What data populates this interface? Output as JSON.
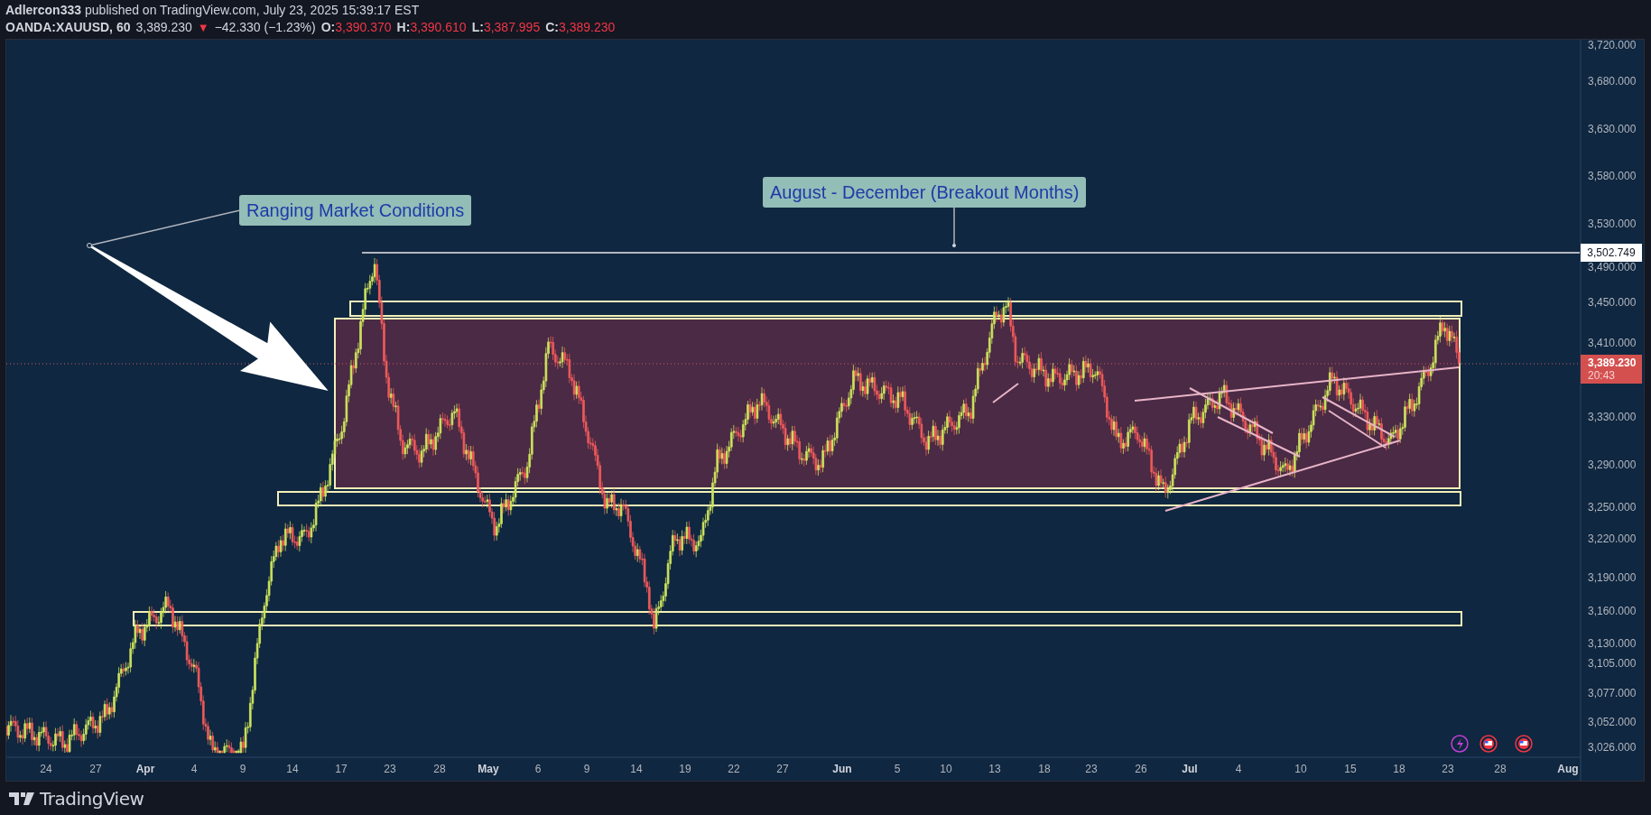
{
  "header": {
    "author": "Adlercon333",
    "published": "published on TradingView.com, July 23, 2025 15:39:17 EST"
  },
  "symbol_line": {
    "symbol": "OANDA:XAUUSD, 60",
    "price": "3,389.230",
    "direction_icon": "▼",
    "change": "−42.330 (−1.23%)",
    "ohlc": [
      {
        "label": "O:",
        "value": "3,390.370"
      },
      {
        "label": "H:",
        "value": "3,390.610"
      },
      {
        "label": "L:",
        "value": "3,387.995"
      },
      {
        "label": "C:",
        "value": "3,389.230"
      }
    ]
  },
  "annotations": [
    {
      "kind": "callout",
      "text": "Ranging Market Conditions"
    },
    {
      "kind": "callout",
      "text": "August - December (Breakout Months)"
    }
  ],
  "price_axis": {
    "labels": [
      "3,720.000",
      "3,680.000",
      "3,630.000",
      "3,580.000",
      "3,530.000",
      "3,490.000",
      "3,450.000",
      "3,410.000",
      "3,330.000",
      "3,290.000",
      "3,250.000",
      "3,220.000",
      "3,190.000",
      "3,160.000",
      "3,130.000",
      "3,105.000",
      "3,077.000",
      "3,052.000",
      "3,026.000"
    ]
  },
  "price_tags": [
    {
      "kind": "line",
      "price": "3,502.749"
    },
    {
      "kind": "last",
      "price": "3,389.230",
      "countdown": "20:43"
    }
  ],
  "time_axis": {
    "labels": [
      {
        "text": "24",
        "kind": "day"
      },
      {
        "text": "27",
        "kind": "day"
      },
      {
        "text": "Apr",
        "kind": "month"
      },
      {
        "text": "4",
        "kind": "day"
      },
      {
        "text": "9",
        "kind": "day"
      },
      {
        "text": "14",
        "kind": "day"
      },
      {
        "text": "17",
        "kind": "day"
      },
      {
        "text": "23",
        "kind": "day"
      },
      {
        "text": "28",
        "kind": "day"
      },
      {
        "text": "May",
        "kind": "month"
      },
      {
        "text": "6",
        "kind": "day"
      },
      {
        "text": "9",
        "kind": "day"
      },
      {
        "text": "14",
        "kind": "day"
      },
      {
        "text": "19",
        "kind": "day"
      },
      {
        "text": "22",
        "kind": "day"
      },
      {
        "text": "27",
        "kind": "day"
      },
      {
        "text": "Jun",
        "kind": "month"
      },
      {
        "text": "5",
        "kind": "day"
      },
      {
        "text": "10",
        "kind": "day"
      },
      {
        "text": "13",
        "kind": "day"
      },
      {
        "text": "18",
        "kind": "day"
      },
      {
        "text": "23",
        "kind": "day"
      },
      {
        "text": "26",
        "kind": "day"
      },
      {
        "text": "Jul",
        "kind": "month"
      },
      {
        "text": "4",
        "kind": "day"
      },
      {
        "text": "10",
        "kind": "day"
      },
      {
        "text": "15",
        "kind": "day"
      },
      {
        "text": "18",
        "kind": "day"
      },
      {
        "text": "23",
        "kind": "day"
      },
      {
        "text": "28",
        "kind": "day"
      },
      {
        "text": "Aug",
        "kind": "month"
      }
    ]
  },
  "footer": {
    "brand": "TradingView"
  }
}
